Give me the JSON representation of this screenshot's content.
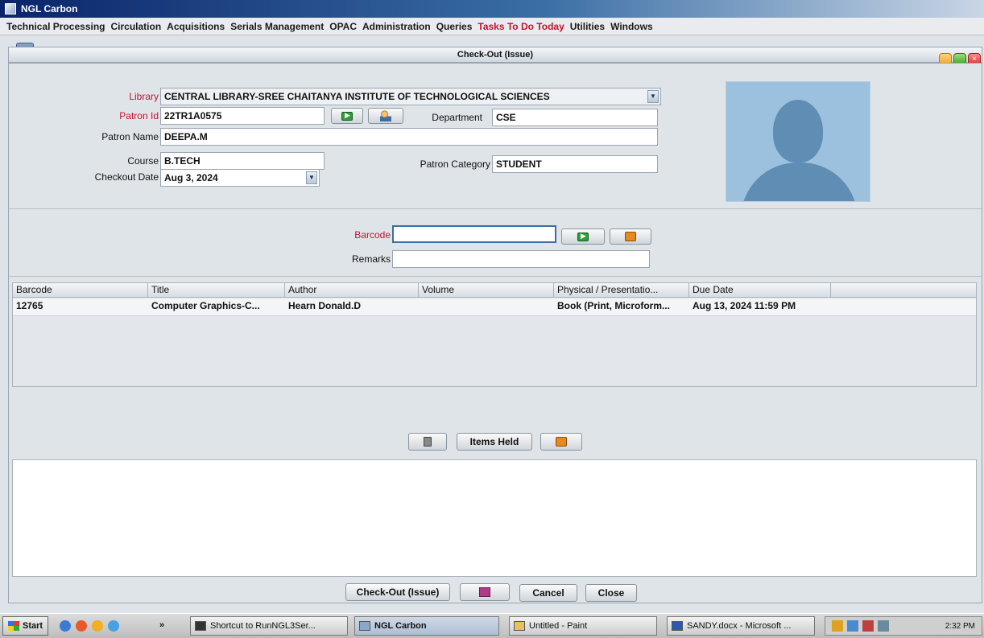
{
  "app": {
    "title": "NGL Carbon",
    "controls": [
      "_",
      "□",
      "×"
    ]
  },
  "menu": [
    {
      "label": "Technical Processing",
      "hot": false
    },
    {
      "label": "Circulation",
      "hot": false
    },
    {
      "label": "Acquisitions",
      "hot": false
    },
    {
      "label": "Serials Management",
      "hot": false
    },
    {
      "label": "OPAC",
      "hot": false
    },
    {
      "label": "Administration",
      "hot": false
    },
    {
      "label": "Queries",
      "hot": false
    },
    {
      "label": "Tasks To Do Today",
      "hot": true
    },
    {
      "label": "Utilities",
      "hot": false
    },
    {
      "label": "Windows",
      "hot": false
    }
  ],
  "frame": {
    "title": "Check-Out (Issue)",
    "close_glyph": "×"
  },
  "form": {
    "library_label": "Library",
    "library_value": "CENTRAL LIBRARY-SREE CHAITANYA INSTITUTE OF TECHNOLOGICAL SCIENCES",
    "patron_id_label": "Patron Id",
    "patron_id_value": "22TR1A0575",
    "department_label": "Department",
    "department_value": "CSE",
    "patron_name_label": "Patron Name",
    "patron_name_value": "DEEPA.M",
    "course_label": "Course",
    "course_value": "B.TECH",
    "patron_category_label": "Patron Category",
    "patron_category_value": "STUDENT",
    "checkout_date_label": "Checkout Date",
    "checkout_date_value": "Aug 3, 2024",
    "dropdown_glyph": "▼"
  },
  "scan": {
    "barcode_label": "Barcode",
    "barcode_value": "",
    "remarks_label": "Remarks",
    "remarks_value": ""
  },
  "table": {
    "columns": [
      "Barcode",
      "Title",
      "Author",
      "Volume",
      "Physical / Presentatio...",
      "Due Date"
    ],
    "rows": [
      {
        "barcode": "12765",
        "title": "Computer Graphics-C...",
        "author": "Hearn Donald.D",
        "volume": "",
        "physical": "Book (Print, Microform...",
        "due_date": "Aug 13, 2024 11:59 PM"
      }
    ]
  },
  "actions_mid": {
    "items_held_label": "Items Held"
  },
  "actions_bottom": {
    "checkout_label": "Check-Out (Issue)",
    "cancel_label": "Cancel",
    "close_label": "Close"
  },
  "taskbar": {
    "start_label": "Start",
    "chevron": "»",
    "items": [
      {
        "label": "Shortcut to RunNGL3Ser...",
        "active": false
      },
      {
        "label": "NGL Carbon",
        "active": true
      },
      {
        "label": "Untitled - Paint",
        "active": false
      },
      {
        "label": "SANDY.docx - Microsoft ...",
        "active": false
      }
    ],
    "clock": "2:32 PM"
  }
}
